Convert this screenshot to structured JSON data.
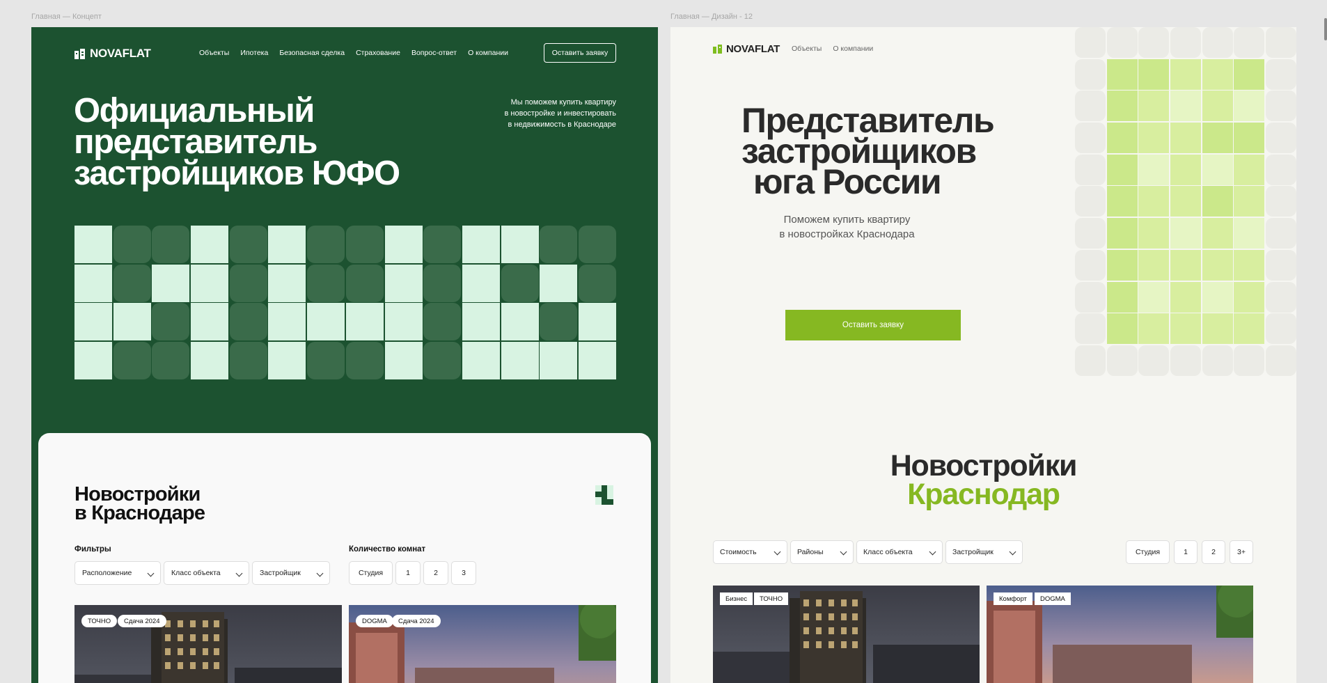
{
  "frames": {
    "left_label": "Главная — Концепт",
    "right_label": "Главная — Дизайн - 12"
  },
  "left": {
    "logo_text": "NOVAFLAT",
    "logo_icon": "building-icon",
    "nav": [
      "Объекты",
      "Ипотека",
      "Безопасная сделка",
      "Страхование",
      "Вопрос-ответ",
      "О компании"
    ],
    "cta": "Оставить заявку",
    "title_lines": [
      "Официальный",
      "представитель",
      "застройщиков ЮФО"
    ],
    "subtitle_lines": [
      "Мы поможем купить квартиру",
      "в новостройке и инвестировать",
      "в недвижимость в Краснодаре"
    ],
    "section_title_lines": [
      "Новостройки",
      "в Краснодаре"
    ],
    "filters_label": "Фильтры",
    "rooms_label": "Количество комнат",
    "filters": [
      "Расположение",
      "Класс объекта",
      "Застройщик"
    ],
    "rooms": [
      "Студия",
      "1",
      "2",
      "3"
    ],
    "cards": [
      {
        "tags": [
          "ТОЧНО",
          "Сдача 2024"
        ]
      },
      {
        "tags": [
          "DOGMA",
          "Сдача 2024"
        ]
      }
    ],
    "colors": {
      "bg": "#1c5230",
      "light": "#d8f3e2",
      "dark_tile": "#3a6b4a"
    }
  },
  "right": {
    "logo_text": "NOVAFLAT",
    "logo_icon": "building-icon",
    "nav": [
      "Объекты",
      "О компании"
    ],
    "title_lines": [
      "Представитель",
      "застройщиков",
      "юга России"
    ],
    "subtitle_lines": [
      "Поможем купить квартиру",
      "в новостройках Краснодара"
    ],
    "cta": "Оставить заявку",
    "section_title_a": "Новостройки",
    "section_title_b": "Краснодар",
    "filters": [
      "Стоимость",
      "Районы",
      "Класс объекта",
      "Застройщик"
    ],
    "rooms": [
      "Студия",
      "1",
      "2",
      "3+"
    ],
    "cards": [
      {
        "tags": [
          "Бизнес",
          "ТОЧНО"
        ]
      },
      {
        "tags": [
          "Комфорт",
          "DOGMA"
        ]
      }
    ],
    "colors": {
      "accent": "#86b822",
      "bg": "#f6f6f2"
    }
  }
}
